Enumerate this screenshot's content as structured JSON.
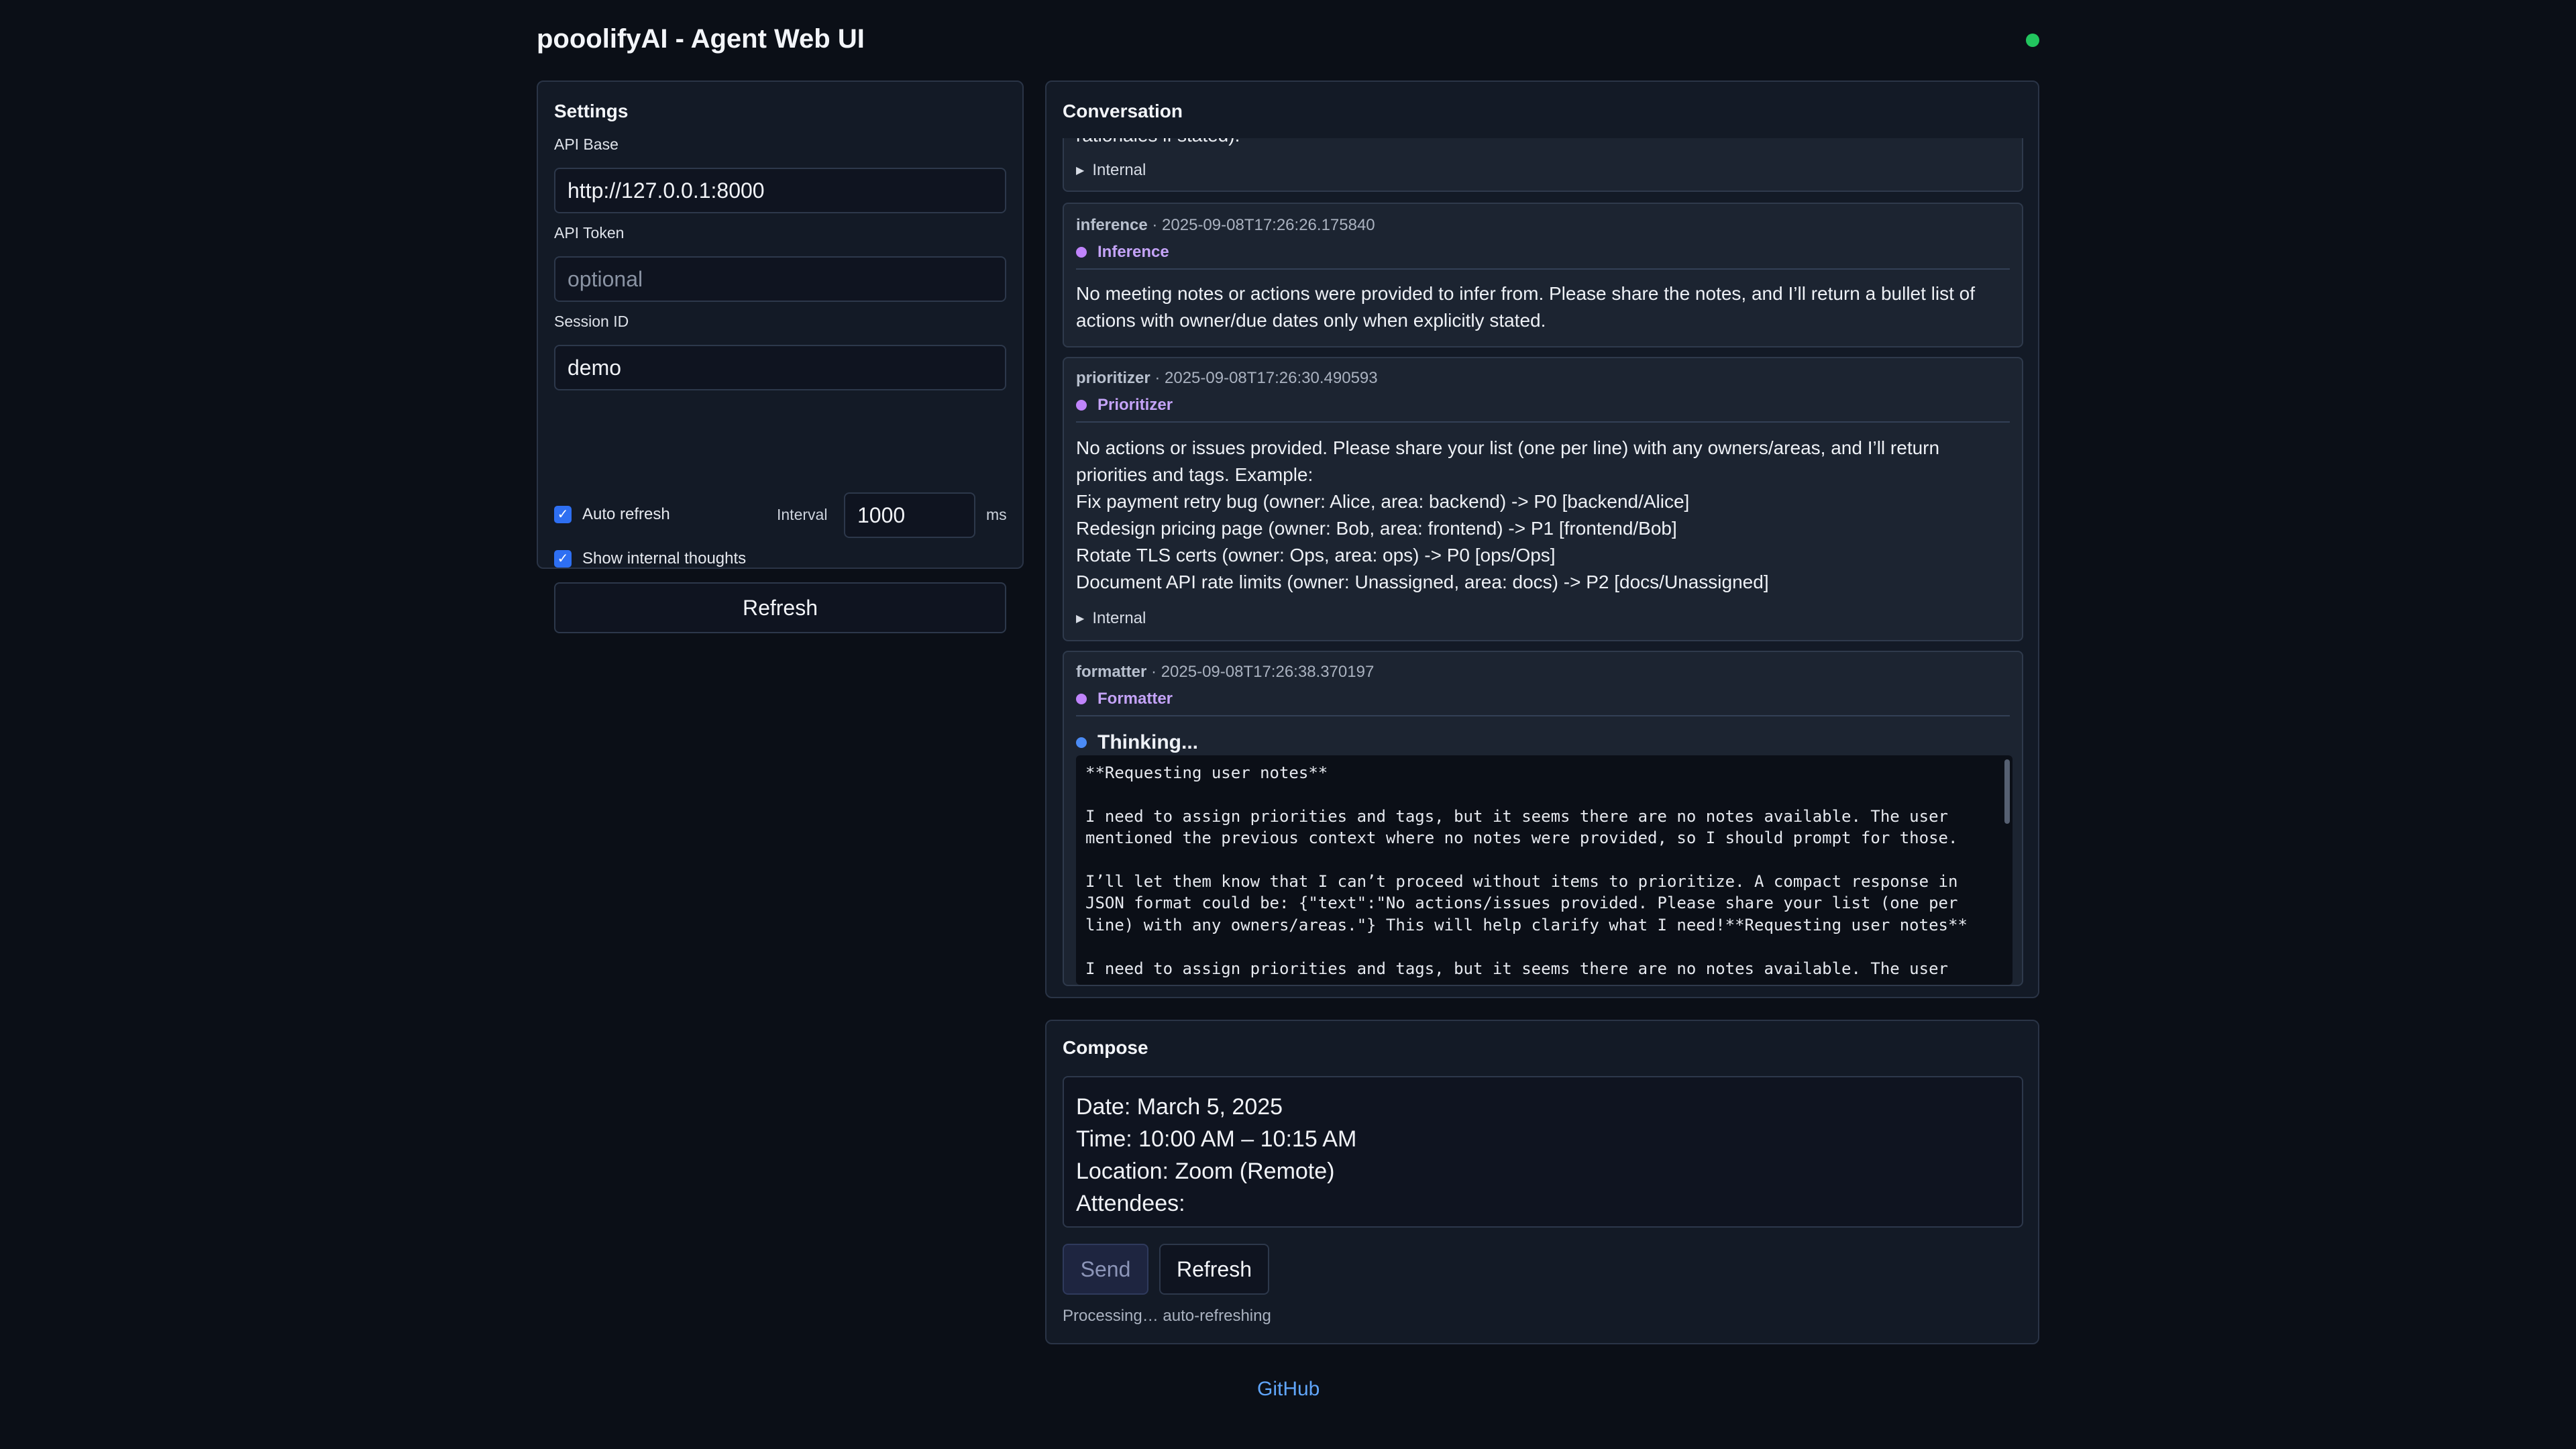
{
  "app": {
    "title": "pooolifyAI - Agent Web UI",
    "status_color": "#22c55e"
  },
  "settings": {
    "title": "Settings",
    "api_base_label": "API Base",
    "api_base_value": "http://127.0.0.1:8000",
    "api_token_label": "API Token",
    "api_token_placeholder": "optional",
    "session_id_label": "Session ID",
    "session_id_value": "demo",
    "auto_refresh_label": "Auto refresh",
    "auto_refresh_checked": true,
    "interval_label": "Interval",
    "interval_value": "1000",
    "interval_unit": "ms",
    "show_internal_label": "Show internal thoughts",
    "show_internal_checked": true,
    "refresh_label": "Refresh"
  },
  "conversation": {
    "title": "Conversation",
    "partial_message": {
      "text_tail": "rationales if stated).",
      "internal_label": "Internal"
    },
    "messages": [
      {
        "agent": "inference",
        "timestamp": "2025-09-08T17:26:26.175840",
        "role": "Inference",
        "text": "No meeting notes or actions were provided to infer from. Please share the notes, and I’ll return a bullet list of actions with owner/due dates only when explicitly stated."
      },
      {
        "agent": "prioritizer",
        "timestamp": "2025-09-08T17:26:30.490593",
        "role": "Prioritizer",
        "lines": [
          "No actions or issues provided. Please share your list (one per line) with any owners/areas, and I’ll return priorities and tags. Example:",
          "Fix payment retry bug (owner: Alice, area: backend) -> P0 [backend/Alice]",
          "Redesign pricing page (owner: Bob, area: frontend) -> P1 [frontend/Bob]",
          "Rotate TLS certs (owner: Ops, area: ops) -> P0 [ops/Ops]",
          "Document API rate limits (owner: Unassigned, area: docs) -> P2 [docs/Unassigned]"
        ],
        "internal_label": "Internal"
      },
      {
        "agent": "formatter",
        "timestamp": "2025-09-08T17:26:38.370197",
        "role": "Formatter",
        "thinking_label": "Thinking...",
        "thinking_text": "**Requesting user notes**\n\nI need to assign priorities and tags, but it seems there are no notes available. The user mentioned the previous context where no notes were provided, so I should prompt for those.\n\nI’ll let them know that I can’t proceed without items to prioritize. A compact response in JSON format could be: {\"text\":\"No actions/issues provided. Please share your list (one per line) with any owners/areas.\"} This will help clarify what I need!**Requesting user notes**\n\nI need to assign priorities and tags, but it seems there are no notes available. The user"
      }
    ]
  },
  "compose": {
    "title": "Compose",
    "text": "Date: March 5, 2025\nTime: 10:00 AM – 10:15 AM\nLocation: Zoom (Remote)\nAttendees:",
    "send_label": "Send",
    "refresh_label": "Refresh",
    "status": "Processing… auto-refreshing"
  },
  "footer": {
    "link_label": "GitHub"
  }
}
